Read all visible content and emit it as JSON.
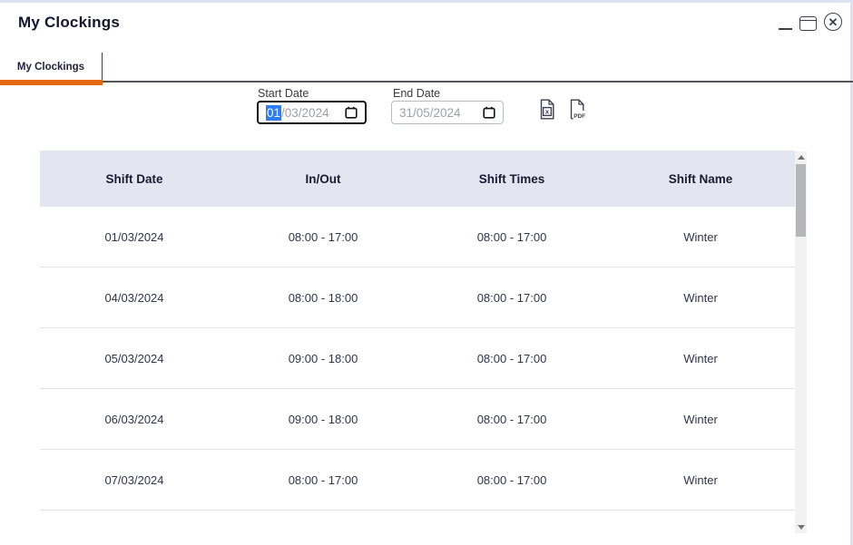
{
  "window": {
    "title": "My Clockings"
  },
  "tabs": [
    {
      "label": "My Clockings",
      "active": true
    }
  ],
  "filters": {
    "start_date": {
      "label": "Start Date",
      "value": "01/03/2024",
      "selected_segment": "01",
      "remainder": "/03/2024"
    },
    "end_date": {
      "label": "End Date",
      "value": "31/05/2024"
    },
    "export": {
      "excel_icon": "export-to-excel",
      "pdf_icon": "export-to-pdf",
      "pdf_text": "PDF",
      "excel_text": "x"
    }
  },
  "table": {
    "columns": [
      "Shift Date",
      "In/Out",
      "Shift Times",
      "Shift Name"
    ],
    "rows": [
      [
        "01/03/2024",
        "08:00 - 17:00",
        "08:00 - 17:00",
        "Winter"
      ],
      [
        "04/03/2024",
        "08:00 - 18:00",
        "08:00 - 17:00",
        "Winter"
      ],
      [
        "05/03/2024",
        "09:00 - 18:00",
        "08:00 - 17:00",
        "Winter"
      ],
      [
        "06/03/2024",
        "09:00 - 18:00",
        "08:00 - 17:00",
        "Winter"
      ],
      [
        "07/03/2024",
        "08:00 - 17:00",
        "08:00 - 17:00",
        "Winter"
      ]
    ]
  },
  "colors": {
    "accent_orange": "#E5690F",
    "dark_line": "#55555E",
    "header_bg": "#E3E6F0",
    "selection_blue": "#2E7CF6",
    "icon_dark": "#3E3E52"
  }
}
